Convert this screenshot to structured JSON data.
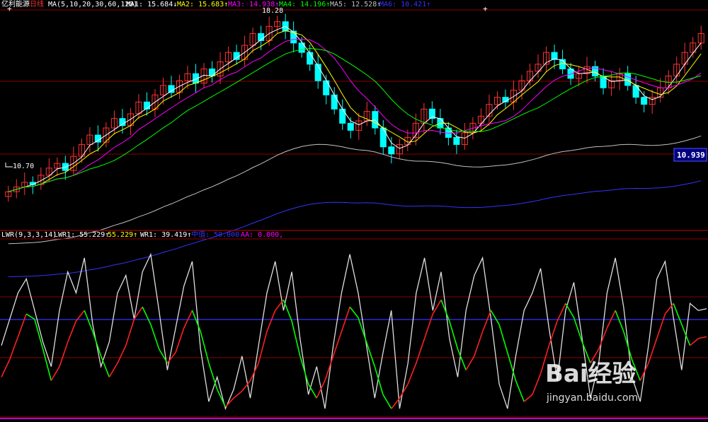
{
  "header": {
    "stock_name": "亿利能源",
    "period": "日线",
    "ma_params": "MA(5,10,20,30,60,120)",
    "items": [
      {
        "label": "MA1: 15.684",
        "arrow": "↓",
        "color": "#ffffff"
      },
      {
        "label": "MA2: 15.683",
        "arrow": "↑",
        "color": "#ffff00"
      },
      {
        "label": "MA3: 14.938",
        "arrow": "↑",
        "color": "#ff00ff"
      },
      {
        "label": "MA4: 14.196",
        "arrow": "↑",
        "color": "#00ff00"
      },
      {
        "label": "MA5: 12.528",
        "arrow": "↑",
        "color": "#c0c0c0"
      },
      {
        "label": "MA6: 10.421",
        "arrow": "↑",
        "color": "#3333ff"
      }
    ]
  },
  "indicator_header": {
    "name": "LWR(9,3,3,14)",
    "items": [
      {
        "label": "LWR1: 55.229",
        "arrow": "↑",
        "color": "#ffffff"
      },
      {
        "label": "55.229",
        "arrow": "↑",
        "color": "#ffff00"
      },
      {
        "label": "WR1: 39.419",
        "arrow": "↑",
        "color": "#ffffff"
      },
      {
        "label": "中值: 50.000",
        "arrow": "",
        "color": "#3333ff"
      },
      {
        "label": "AA: 0.000,",
        "arrow": "",
        "color": "#ff00ff"
      }
    ]
  },
  "price_badge": "10.939",
  "annotations": {
    "high": "18.28",
    "low": "10.70"
  },
  "watermark": {
    "main": "Bai经验",
    "sub": "jingyan.baidu.com"
  },
  "colors": {
    "up": "#ff3333",
    "down": "#00ffff",
    "ma1": "#ffffff",
    "ma2": "#ffff00",
    "ma3": "#ff00ff",
    "ma4": "#00ff00",
    "ma5": "#c0c0c0",
    "ma6": "#3333ff",
    "grid": "#8b0000",
    "midline": "#3333ff"
  },
  "chart_data": [
    {
      "type": "candlestick",
      "title": "亿利能源 日线",
      "ylim": [
        9.5,
        18.6
      ],
      "ma_values": {
        "MA1": 15.684,
        "MA2": 15.683,
        "MA3": 14.938,
        "MA4": 14.196,
        "MA5": 12.528,
        "MA6": 10.421
      },
      "highest": 18.28,
      "lowest": 10.7,
      "last_price_marker": 10.939,
      "closes": [
        10.9,
        11.1,
        11.3,
        11.2,
        11.6,
        11.9,
        12.1,
        11.8,
        12.4,
        12.9,
        13.3,
        13.0,
        13.6,
        14.0,
        13.7,
        14.2,
        14.7,
        14.4,
        15.0,
        15.4,
        15.1,
        15.6,
        15.9,
        15.5,
        16.1,
        15.8,
        16.4,
        16.8,
        16.5,
        17.1,
        17.6,
        17.3,
        17.9,
        18.1,
        17.7,
        17.2,
        16.8,
        16.3,
        15.6,
        15.0,
        14.4,
        13.8,
        13.5,
        13.9,
        14.3,
        13.6,
        12.8,
        12.5,
        12.9,
        13.2,
        13.8,
        14.4,
        14.0,
        13.6,
        13.2,
        12.9,
        13.4,
        13.8,
        14.1,
        14.6,
        14.9,
        14.7,
        15.2,
        15.6,
        16.0,
        16.3,
        16.8,
        16.5,
        16.1,
        15.7,
        15.9,
        16.2,
        15.8,
        15.3,
        15.6,
        15.9,
        15.4,
        14.9,
        14.6,
        14.9,
        15.3,
        15.8,
        16.3,
        16.8,
        17.2,
        17.6
      ]
    },
    {
      "type": "line",
      "title": "LWR(9,3,3,14)",
      "ylim": [
        0,
        100
      ],
      "series_names": [
        "LWR1",
        "WR1"
      ],
      "latest": {
        "LWR1": 55.229,
        "LWR2": 55.229,
        "WR1": 39.419,
        "中值": 50.0,
        "AA": 0.0
      },
      "lwr1": [
        78,
        68,
        55,
        42,
        45,
        62,
        80,
        72,
        58,
        46,
        40,
        52,
        66,
        78,
        70,
        60,
        45,
        38,
        48,
        62,
        70,
        64,
        50,
        40,
        52,
        70,
        85,
        95,
        90,
        86,
        80,
        70,
        52,
        40,
        34,
        46,
        66,
        82,
        90,
        80,
        66,
        52,
        38,
        44,
        58,
        72,
        88,
        96,
        90,
        82,
        70,
        56,
        42,
        34,
        46,
        62,
        74,
        66,
        52,
        40,
        48,
        64,
        80,
        92,
        88,
        76,
        60,
        46,
        36,
        44,
        58,
        70,
        62,
        50,
        40,
        52,
        68,
        80,
        70,
        56,
        42,
        36,
        48,
        60,
        56,
        55
      ],
      "wr1": [
        60,
        45,
        30,
        22,
        40,
        58,
        72,
        40,
        18,
        30,
        10,
        48,
        72,
        58,
        30,
        20,
        45,
        18,
        8,
        40,
        74,
        50,
        26,
        12,
        62,
        92,
        78,
        96,
        85,
        66,
        90,
        60,
        30,
        12,
        40,
        18,
        56,
        88,
        72,
        96,
        60,
        30,
        8,
        30,
        60,
        90,
        64,
        40,
        96,
        70,
        30,
        10,
        40,
        18,
        56,
        78,
        40,
        20,
        10,
        44,
        82,
        96,
        66,
        40,
        30,
        16,
        50,
        80,
        40,
        24,
        56,
        90,
        70,
        30,
        10,
        38,
        78,
        92,
        60,
        22,
        12,
        44,
        74,
        36,
        40,
        39
      ]
    }
  ]
}
